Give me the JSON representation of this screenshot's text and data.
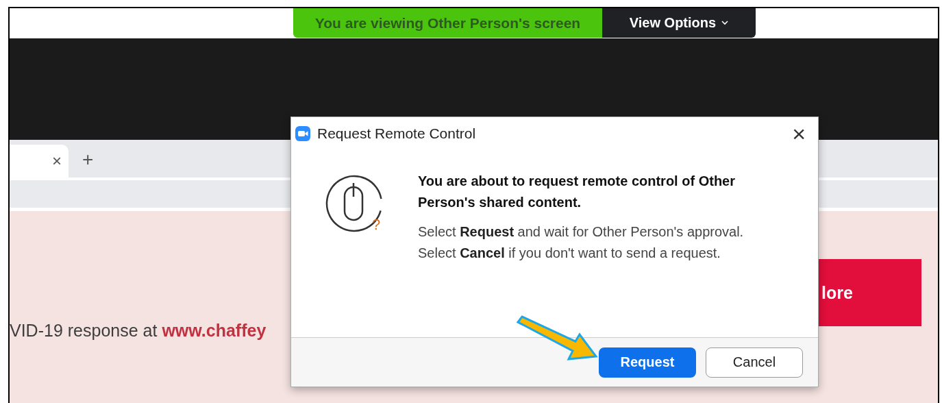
{
  "banner": {
    "status": "You are viewing Other Person's screen",
    "view_options": "View Options"
  },
  "shared_screen": {
    "tab_close": "×",
    "new_tab": "+",
    "page_text": "VID-19 response at",
    "page_link": "www.chaffey",
    "red_button": "lore"
  },
  "dialog": {
    "title": "Request Remote Control",
    "close": "×",
    "badge": "?",
    "heading": "You are about to request remote control of Other Person's shared content.",
    "lines": [
      "Select **Request** and wait for Other Person's approval.",
      "Select **Cancel** if you don't want to send a request."
    ],
    "buttons": [
      {
        "label": "Request",
        "kind": "primary"
      },
      {
        "label": "Cancel",
        "kind": "secondary"
      }
    ]
  }
}
